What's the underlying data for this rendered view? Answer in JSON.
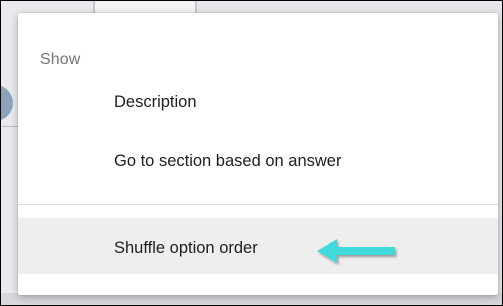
{
  "menu": {
    "header": "Show",
    "items": [
      {
        "label": "Description"
      },
      {
        "label": "Go to section based on answer"
      },
      {
        "label": "Shuffle option order",
        "highlighted": true
      }
    ]
  },
  "annotation": {
    "icon": "left-arrow-icon",
    "color": "#3fd9dc"
  }
}
